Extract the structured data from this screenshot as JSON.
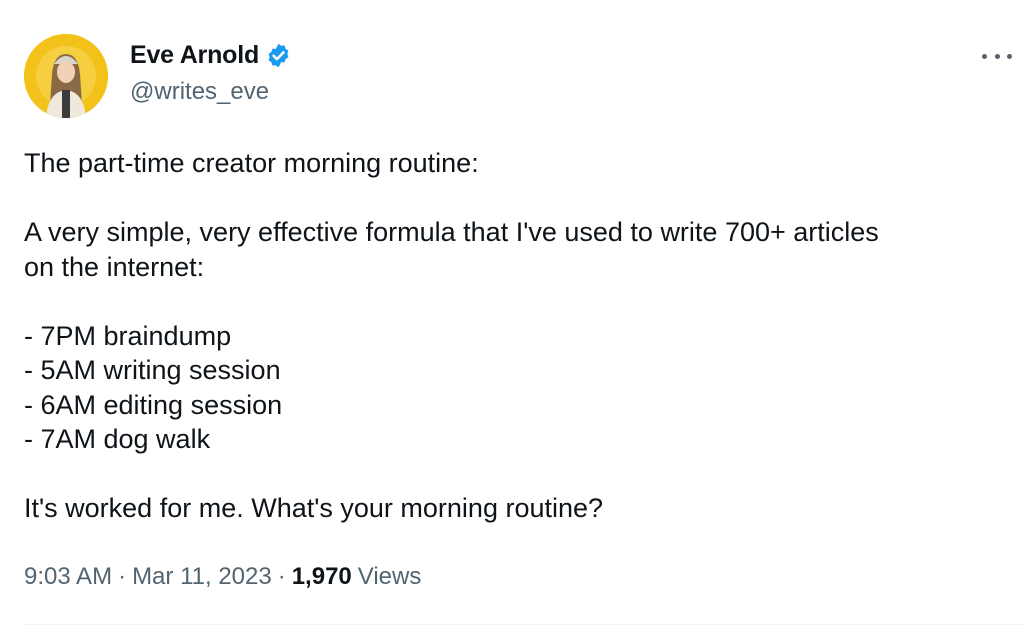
{
  "author": {
    "name": "Eve Arnold",
    "handle": "@writes_eve",
    "verified": true,
    "verified_color": "#1d9bf0",
    "avatar_bg": "#f2c21a"
  },
  "menu_icon": "more-horizontal-icon",
  "tweet": {
    "lines": [
      "The part-time creator morning routine:",
      "",
      "A very simple, very effective formula that I've used to write 700+ articles",
      "on the internet:",
      "",
      "- 7PM braindump",
      "- 5AM writing session",
      "- 6AM editing session",
      "- 7AM dog walk",
      "",
      "It's worked for me. What's your morning routine?"
    ]
  },
  "meta": {
    "time": "9:03 AM",
    "separator": "·",
    "date": "Mar 11, 2023",
    "views_count": "1,970",
    "views_label": "Views"
  }
}
